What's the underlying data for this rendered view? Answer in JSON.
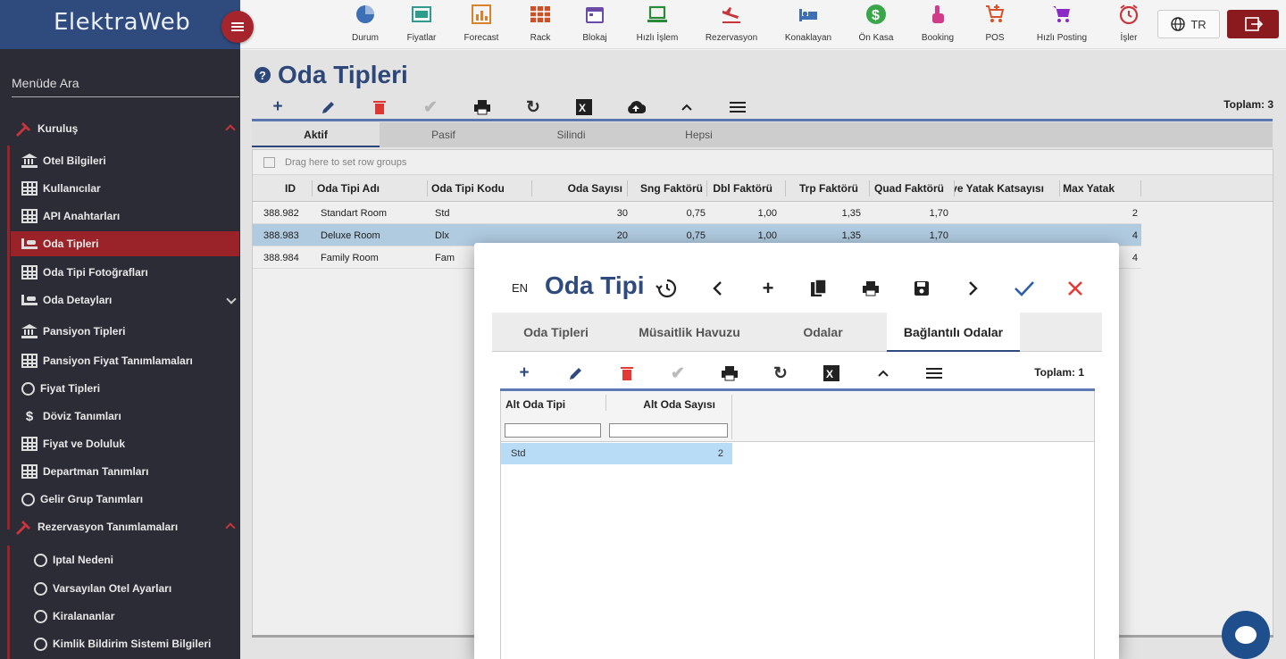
{
  "app": {
    "logo": "ElektraWeb"
  },
  "topnav": [
    {
      "label": "Durum",
      "icon": "pie-chart-icon",
      "color": "#3d6fb6"
    },
    {
      "label": "Fiyatlar",
      "icon": "price-board-icon",
      "color": "#2e9c8a"
    },
    {
      "label": "Forecast",
      "icon": "forecast-chart-icon",
      "color": "#d8822b"
    },
    {
      "label": "Rack",
      "icon": "rack-grid-icon",
      "color": "#c8522a"
    },
    {
      "label": "Blokaj",
      "icon": "calendar-icon",
      "color": "#6a4ca8"
    },
    {
      "label": "Hızlı İşlem",
      "icon": "laptop-icon",
      "color": "#2a8a3a"
    },
    {
      "label": "Rezervasyon",
      "icon": "plane-landing-icon",
      "color": "#c8353b"
    },
    {
      "label": "Konaklayan",
      "icon": "bed-icon",
      "color": "#3d6fb6"
    },
    {
      "label": "Ön Kasa",
      "icon": "dollar-coin-icon",
      "color": "#3aa64a"
    },
    {
      "label": "Booking",
      "icon": "hand-pointer-icon",
      "color": "#d23b8a"
    },
    {
      "label": "POS",
      "icon": "cart-plus-icon",
      "color": "#d8512b"
    },
    {
      "label": "Hızlı Posting",
      "icon": "cart-icon",
      "color": "#8a2bc8"
    },
    {
      "label": "İşler",
      "icon": "alarm-clock-icon",
      "color": "#c8353b"
    }
  ],
  "header": {
    "language": "TR"
  },
  "sidebar": {
    "search_placeholder": "Menüde Ara",
    "group_kurulus": "Kuruluş",
    "items": [
      {
        "label": "Otel Bilgileri"
      },
      {
        "label": "Kullanıcılar"
      },
      {
        "label": "API Anahtarları"
      },
      {
        "label": "Oda Tipleri"
      },
      {
        "label": "Oda Tipi Fotoğrafları"
      },
      {
        "label": "Oda Detayları"
      },
      {
        "label": "Pansiyon Tipleri"
      },
      {
        "label": "Pansiyon Fiyat Tanımlamaları"
      },
      {
        "label": "Fiyat Tipleri"
      },
      {
        "label": "Döviz Tanımları"
      },
      {
        "label": "Fiyat ve Doluluk"
      },
      {
        "label": "Departman Tanımları"
      },
      {
        "label": "Gelir Grup Tanımları"
      }
    ],
    "group_rez": "Rezervasyon Tanımlamaları",
    "sub_items": [
      {
        "label": "Iptal Nedeni"
      },
      {
        "label": "Varsayılan Otel Ayarları"
      },
      {
        "label": "Kiralananlar"
      },
      {
        "label": "Kimlik Bildirim Sistemi Bilgileri"
      }
    ]
  },
  "page": {
    "title": "Oda Tipleri",
    "total": "Toplam: 3",
    "tabs": [
      "Aktif",
      "Pasif",
      "Silindi",
      "Hepsi"
    ],
    "group_hint": "Drag here to set row groups",
    "columns": [
      "ID",
      "Oda Tipi Adı",
      "Oda Tipi Kodu",
      "Oda Sayısı",
      "Sng Faktörü",
      "Dbl Faktörü",
      "Trp Faktörü",
      "Quad Faktörü",
      "İlave Yatak Katsayısı",
      "Max Yatak"
    ],
    "rows": [
      {
        "id": "388.982",
        "name": "Standart Room",
        "code": "Std",
        "count": "30",
        "sng": "0,75",
        "dbl": "1,00",
        "trp": "1,35",
        "quad": "1,70",
        "extra": "",
        "max": "2"
      },
      {
        "id": "388.983",
        "name": "Deluxe Room",
        "code": "Dlx",
        "count": "20",
        "sng": "0,75",
        "dbl": "1,00",
        "trp": "1,35",
        "quad": "1,70",
        "extra": "",
        "max": "4"
      },
      {
        "id": "388.984",
        "name": "Family Room",
        "code": "Fam",
        "count": "",
        "sng": "",
        "dbl": "",
        "trp": "",
        "quad": "",
        "extra": "",
        "max": "4"
      }
    ]
  },
  "modal": {
    "lang": "EN",
    "title": "Oda Tipi",
    "tabs": [
      "Oda Tipleri",
      "Müsaitlik Havuzu",
      "Odalar",
      "Bağlantılı Odalar"
    ],
    "total": "Toplam: 1",
    "columns": [
      "Alt Oda Tipi",
      "Alt Oda Sayısı"
    ],
    "rows": [
      {
        "type": "Std",
        "count": "2"
      }
    ]
  },
  "colors": {
    "brand": "#2f4a7d",
    "accent_red": "#9a2329",
    "selected_row": "#b6d1e8"
  }
}
